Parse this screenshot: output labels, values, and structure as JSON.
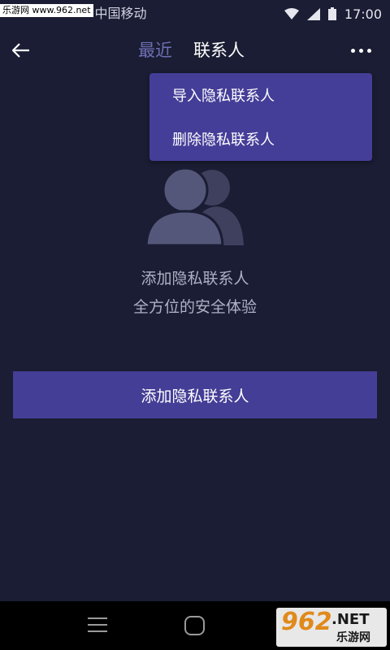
{
  "status_bar": {
    "watermark": "乐游网 www.962.net",
    "carrier": "中国移动",
    "time": "17:00",
    "icons": [
      "wifi-icon",
      "signal-icon",
      "battery-icon"
    ]
  },
  "header": {
    "back_icon": "arrow-left-icon",
    "tab_recent": "最近",
    "tab_contacts": "联系人",
    "more_icon": "more-dots-icon"
  },
  "menu": {
    "items": [
      {
        "label": "导入隐私联系人"
      },
      {
        "label": "删除隐私联系人"
      }
    ]
  },
  "empty_state": {
    "icon": "contacts-icon",
    "line1": "添加隐私联系人",
    "line2": "全方位的安全体验"
  },
  "actions": {
    "add_label": "添加隐私联系人"
  },
  "nav_bar": {
    "icons": [
      "menu-icon",
      "home-icon"
    ]
  },
  "watermark_logo": {
    "number": "962",
    "net": ".NET",
    "cn": "乐游网"
  },
  "colors": {
    "background": "#1a1d33",
    "accent": "#443e96",
    "tab_inactive": "#6e6fb3",
    "text_muted": "#aeb0c6"
  }
}
